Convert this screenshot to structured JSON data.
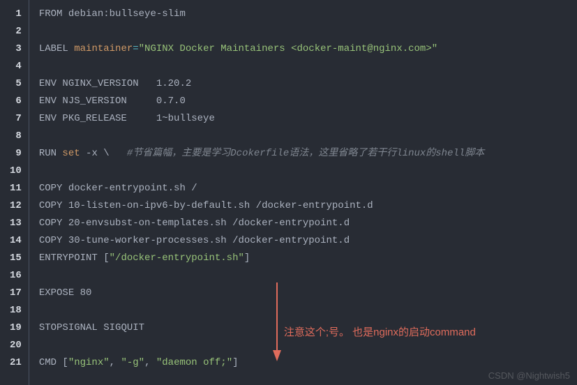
{
  "gutter": [
    "1",
    "2",
    "3",
    "4",
    "5",
    "6",
    "7",
    "8",
    "9",
    "10",
    "11",
    "12",
    "13",
    "14",
    "15",
    "16",
    "17",
    "18",
    "19",
    "20",
    "21"
  ],
  "lines": {
    "l1_kw": "FROM ",
    "l1_rest": "debian:bullseye-slim",
    "l3_kw": "LABEL ",
    "l3_key": "maintainer",
    "l3_op": "=",
    "l3_str": "\"NGINX Docker Maintainers <docker-maint@nginx.com>\"",
    "l5_kw": "ENV ",
    "l5_key": "NGINX_VERSION",
    "l5_val": "   1.20.2",
    "l6_kw": "ENV ",
    "l6_key": "NJS_VERSION",
    "l6_val": "     0.7.0",
    "l7_kw": "ENV ",
    "l7_key": "PKG_RELEASE",
    "l7_val": "     1~bullseye",
    "l9_kw": "RUN ",
    "l9_cmd": "set",
    "l9_arg": " -x \\   ",
    "l9_cmt": "#节省篇幅，主要是学习Dcokerfile语法，这里省略了若干行linux的shell脚本",
    "l11_kw": "COPY ",
    "l11_rest": "docker-entrypoint.sh /",
    "l12_kw": "COPY ",
    "l12_rest": "10-listen-on-ipv6-by-default.sh /docker-entrypoint.d",
    "l13_kw": "COPY ",
    "l13_rest": "20-envsubst-on-templates.sh /docker-entrypoint.d",
    "l14_kw": "COPY ",
    "l14_rest": "30-tune-worker-processes.sh /docker-entrypoint.d",
    "l15_kw": "ENTRYPOINT ",
    "l15_br1": "[",
    "l15_str": "\"/docker-entrypoint.sh\"",
    "l15_br2": "]",
    "l17_kw": "EXPOSE ",
    "l17_val": "80",
    "l19_kw": "STOPSIGNAL ",
    "l19_val": "SIGQUIT",
    "l21_kw": "CMD ",
    "l21_br1": "[",
    "l21_s1": "\"nginx\"",
    "l21_c1": ", ",
    "l21_s2": "\"-g\"",
    "l21_c2": ", ",
    "l21_s3": "\"daemon off;\"",
    "l21_br2": "]"
  },
  "annotation": "注意这个;号。  也是nginx的启动command",
  "watermark": "CSDN @Nightwish5"
}
